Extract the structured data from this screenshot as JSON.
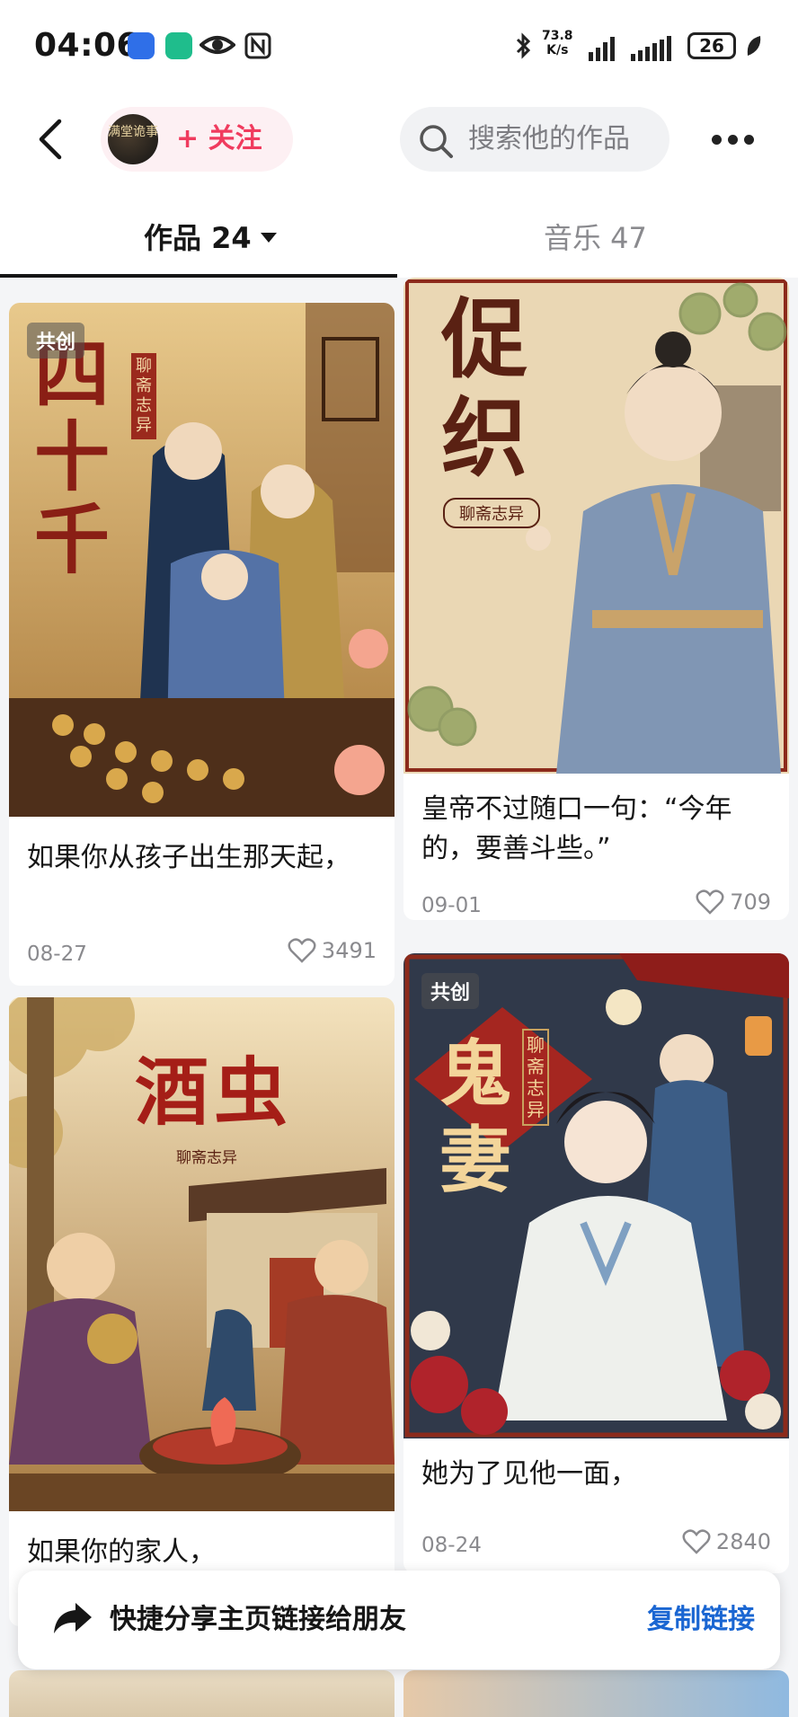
{
  "status_bar": {
    "time": "04:06",
    "net_speed_value": "73.8",
    "net_speed_unit": "K/s",
    "battery": "26",
    "icons": [
      "shield-app-icon",
      "green-app-icon",
      "eye-icon",
      "nfc-icon",
      "bluetooth-icon",
      "signal-icon",
      "signal-icon",
      "battery-icon",
      "leaf-icon"
    ]
  },
  "header": {
    "avatar_text": "满堂诡事",
    "follow_label": "+ 关注",
    "search_placeholder": "搜索他的作品"
  },
  "tabs": [
    {
      "label": "作品 24",
      "active": true
    },
    {
      "label": "音乐 47",
      "active": false
    }
  ],
  "posts": [
    {
      "cover_title": "四十千",
      "cover_series": "聊斋志异",
      "badge": "共创",
      "title": "如果你从孩子出生那天起，",
      "date": "08-27",
      "likes": "3491"
    },
    {
      "cover_title": "促织",
      "cover_series": "聊斋志异",
      "badge": "",
      "title": "皇帝不过随口一句：“今年的，要善斗些。”",
      "date": "09-01",
      "likes": "709"
    },
    {
      "cover_title": "酒虫",
      "cover_series": "聊斋志异",
      "badge": "",
      "title": "如果你的家人，",
      "date": "",
      "likes": ""
    },
    {
      "cover_title": "鬼妻",
      "cover_series": "聊斋志异",
      "badge": "共创",
      "title": "她为了见他一面，",
      "date": "08-24",
      "likes": "2840"
    }
  ],
  "share_banner": {
    "text": "快捷分享主页链接给朋友",
    "action": "复制链接"
  },
  "colors": {
    "accent_pink": "#f03b5e",
    "link_blue": "#1a66d2",
    "muted_gray": "#8a8a8e"
  }
}
